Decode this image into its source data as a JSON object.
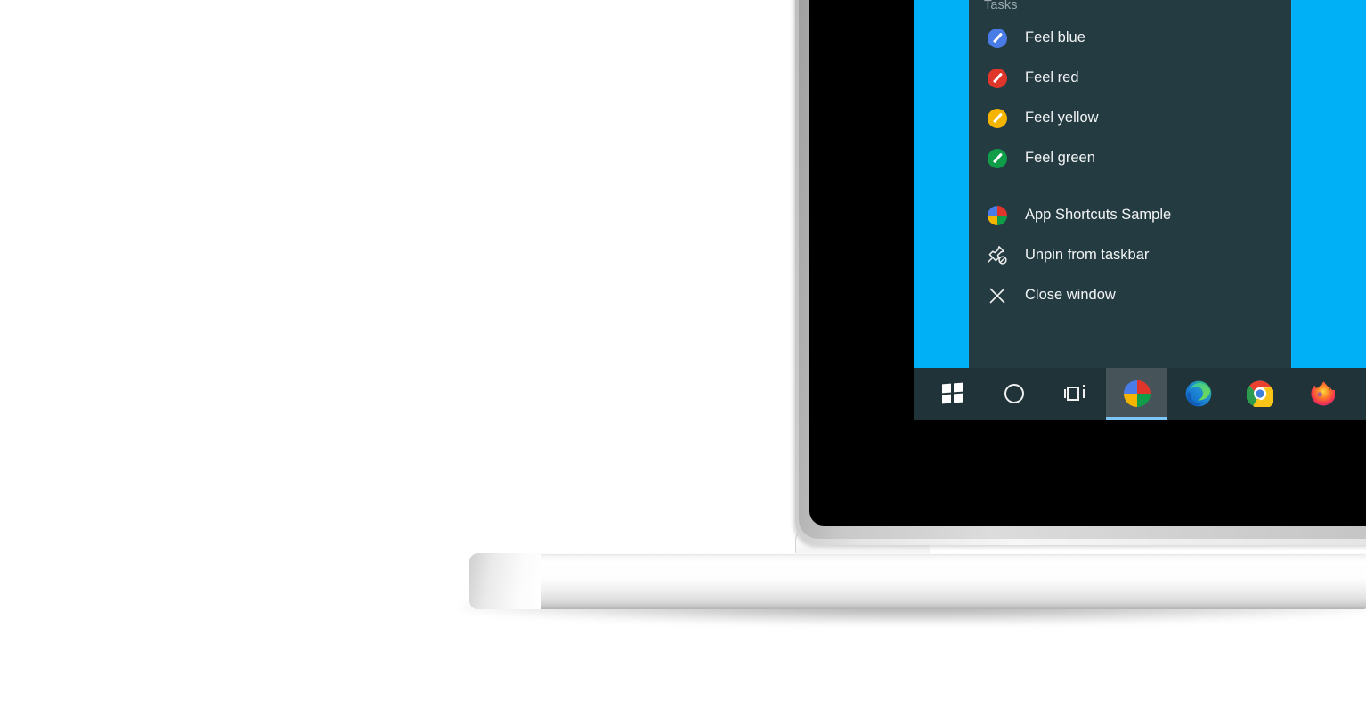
{
  "desktop": {
    "background_color": "#00b0f7"
  },
  "taskbar": {
    "background_color": "#1f3339",
    "active_highlight_color": "#46545a",
    "active_underline_color": "#7cc6f5",
    "buttons": [
      {
        "name": "start",
        "label": "Start",
        "icon": "windows-logo-icon",
        "active": false
      },
      {
        "name": "cortana",
        "label": "Cortana",
        "icon": "cortana-circle-icon",
        "active": false
      },
      {
        "name": "task-view",
        "label": "Task View",
        "icon": "task-view-icon",
        "active": false
      },
      {
        "name": "app-shortcuts-sample",
        "label": "App Shortcuts Sample",
        "icon": "pinwheel-icon",
        "active": true
      },
      {
        "name": "microsoft-edge",
        "label": "Microsoft Edge",
        "icon": "edge-icon",
        "active": false
      },
      {
        "name": "google-chrome",
        "label": "Google Chrome",
        "icon": "chrome-icon",
        "active": false
      },
      {
        "name": "firefox",
        "label": "Firefox",
        "icon": "firefox-icon",
        "active": false
      }
    ]
  },
  "jumplist": {
    "background_color": "#243b42",
    "header": "Tasks",
    "header_color": "#9aa8ad",
    "tasks": [
      {
        "label": "Feel blue",
        "icon": "brush-circle-icon",
        "color": "#4a7ce8"
      },
      {
        "label": "Feel red",
        "icon": "brush-circle-icon",
        "color": "#e0352b"
      },
      {
        "label": "Feel yellow",
        "icon": "brush-circle-icon",
        "color": "#f5b400"
      },
      {
        "label": "Feel green",
        "icon": "brush-circle-icon",
        "color": "#0f9d48"
      }
    ],
    "actions": [
      {
        "label": "App Shortcuts Sample",
        "icon": "pinwheel-icon"
      },
      {
        "label": "Unpin from taskbar",
        "icon": "unpin-icon"
      },
      {
        "label": "Close window",
        "icon": "close-icon"
      }
    ]
  },
  "pinwheel_colors": {
    "top_left": "#4a7ce8",
    "top_right": "#e0352b",
    "bottom_left": "#f5b400",
    "bottom_right": "#0f9d48"
  }
}
